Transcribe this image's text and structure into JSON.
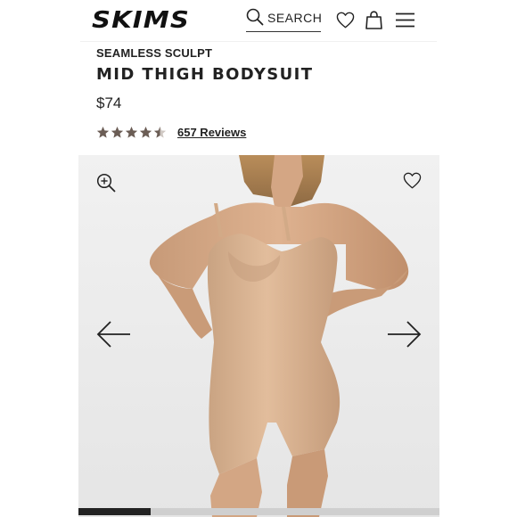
{
  "header": {
    "logo": "SKIMS",
    "search_label": "SEARCH",
    "icons": [
      "search-icon",
      "heart-icon",
      "shopping-bag-icon",
      "menu-icon"
    ]
  },
  "product": {
    "collection": "SEAMLESS SCULPT",
    "title": "MID THIGH BODYSUIT",
    "price": "$74",
    "rating": 4.5,
    "rating_max": 5,
    "reviews_label": "657 Reviews"
  },
  "gallery": {
    "image_description_icon": "product-photo",
    "progress_fraction": 0.2
  },
  "colors": {
    "text": "#222222",
    "star": "#6b5d55",
    "garment": "#d9b08f"
  }
}
